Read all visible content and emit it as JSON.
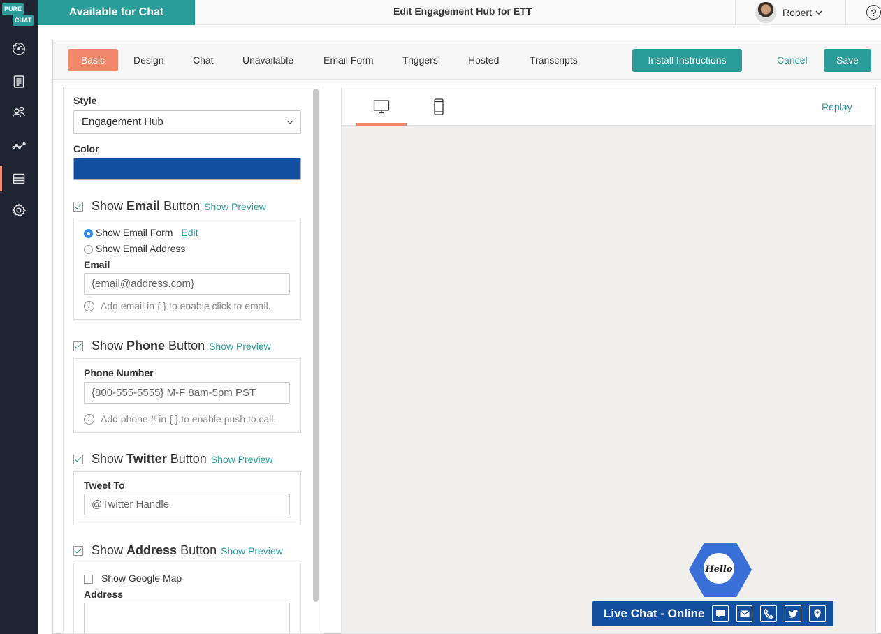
{
  "app": {
    "logo_top": "PURE",
    "logo_bottom": "CHAT",
    "status": "Available for Chat",
    "page_title": "Edit Engagement Hub for ETT",
    "user_name": "Robert",
    "help_glyph": "?"
  },
  "nav_icons": [
    "dashboard-icon",
    "transcripts-icon",
    "contacts-icon",
    "analytics-icon",
    "widgets-icon",
    "settings-icon"
  ],
  "tabs": {
    "items": [
      "Basic",
      "Design",
      "Chat",
      "Unavailable",
      "Email Form",
      "Triggers",
      "Hosted",
      "Transcripts"
    ],
    "active": "Basic",
    "install_label": "Install Instructions",
    "cancel_label": "Cancel",
    "save_label": "Save"
  },
  "settings": {
    "style_label": "Style",
    "style_value": "Engagement Hub",
    "color_label": "Color",
    "color_value": "#134f9e",
    "show_preview_label": "Show Preview",
    "email": {
      "prefix": "Show",
      "bold": "Email",
      "suffix": "Button",
      "checked": true,
      "option_form": "Show Email Form",
      "option_form_edit": "Edit",
      "option_address": "Show Email Address",
      "selected_option": "Show Email Form",
      "field_label": "Email",
      "placeholder": "{email@address.com}",
      "hint": "Add email in { } to enable click to email."
    },
    "phone": {
      "prefix": "Show",
      "bold": "Phone",
      "suffix": "Button",
      "checked": true,
      "field_label": "Phone Number",
      "placeholder": "{800-555-5555} M-F 8am-5pm PST",
      "hint": "Add phone # in { } to enable push to call."
    },
    "twitter": {
      "prefix": "Show",
      "bold": "Twitter",
      "suffix": "Button",
      "checked": true,
      "field_label": "Tweet To",
      "placeholder": "@Twitter Handle"
    },
    "address": {
      "prefix": "Show",
      "bold": "Address",
      "suffix": "Button",
      "checked": true,
      "map_label": "Show Google Map",
      "map_checked": false,
      "field_label": "Address",
      "value": ""
    }
  },
  "preview": {
    "replay_label": "Replay",
    "device_tabs": [
      "desktop-icon",
      "mobile-icon"
    ],
    "active_device": "desktop",
    "hello_text": "Hello",
    "livechat_label": "Live Chat - Online",
    "livechat_buttons": [
      "chat-icon",
      "email-icon",
      "phone-icon",
      "twitter-icon",
      "location-icon"
    ]
  },
  "colors": {
    "accent": "#2a9c9a",
    "active_tab": "#f28669",
    "widget_blue": "#134f9e",
    "hex_blue": "#3a6fd8"
  }
}
